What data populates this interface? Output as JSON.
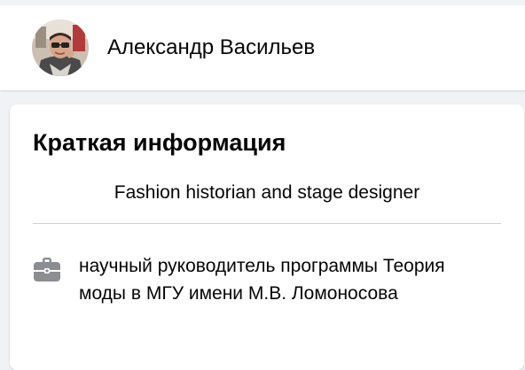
{
  "profile": {
    "name": "Александр Васильев",
    "avatar_icon": "person-photo"
  },
  "intro": {
    "title": "Краткая информация",
    "bio": "Fashion historian and stage designer",
    "work": {
      "icon": "briefcase-icon",
      "text": "научный руководитель программы Теория моды в МГУ имени М.В. Ломоносова"
    }
  },
  "colors": {
    "background": "#f0f2f5",
    "card": "#ffffff",
    "text": "#050505",
    "icon": "#8a8d91",
    "divider": "#ced0d4"
  }
}
